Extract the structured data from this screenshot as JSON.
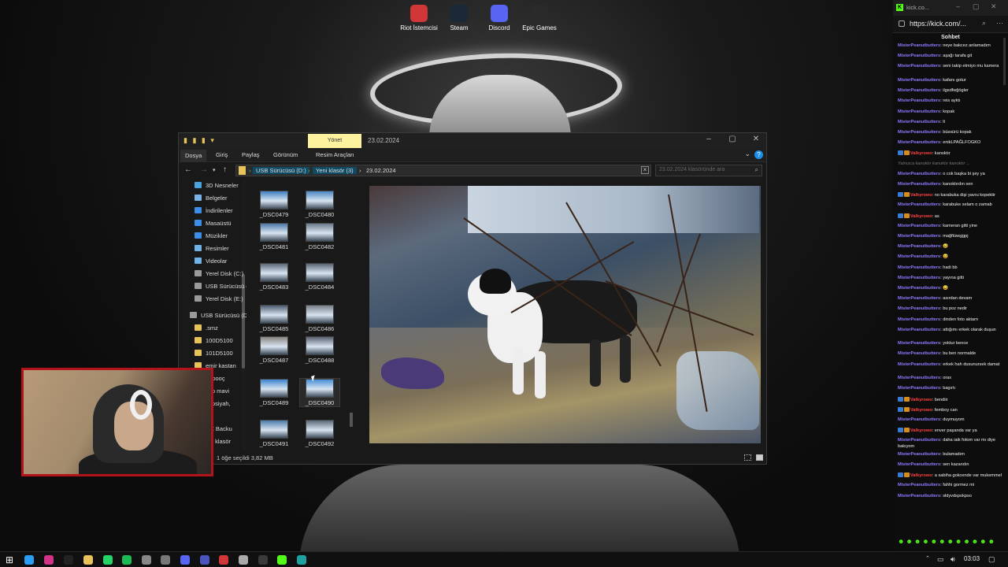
{
  "desktop": {
    "icons": [
      {
        "label": "Riot İstemcisi",
        "icon": "riot-icon",
        "color": "#d13639"
      },
      {
        "label": "Steam",
        "icon": "steam-icon",
        "color": "#1b2838"
      },
      {
        "label": "Discord",
        "icon": "discord-icon",
        "color": "#5865f2"
      },
      {
        "label": "Epic Games",
        "icon": "epic-games-icon",
        "color": "#2a2a2a"
      }
    ]
  },
  "explorer": {
    "title": "23.02.2024",
    "context_tab": "Yönet",
    "ribbon_tabs": [
      "Dosya",
      "Giriş",
      "Paylaş",
      "Görünüm",
      "Resim Araçları"
    ],
    "path": [
      "USB Sürücüsü (D:)",
      "Yeni klasör (3)",
      "23.02.2024"
    ],
    "search_placeholder": "23.02.2024 klasöründe ara",
    "nav_items": [
      {
        "label": "3D Nesneler",
        "icon": "3d-objects-icon",
        "color": "#4aa3df"
      },
      {
        "label": "Belgeler",
        "icon": "documents-icon",
        "color": "#7ab3e8"
      },
      {
        "label": "İndirilenler",
        "icon": "downloads-icon",
        "color": "#3d8ee8"
      },
      {
        "label": "Masaüstü",
        "icon": "desktop-icon",
        "color": "#3d8ee8"
      },
      {
        "label": "Müzikler",
        "icon": "music-icon",
        "color": "#3d8ee8"
      },
      {
        "label": "Resimler",
        "icon": "pictures-icon",
        "color": "#6fb3e8"
      },
      {
        "label": "Videolar",
        "icon": "videos-icon",
        "color": "#6fb3e8"
      },
      {
        "label": "Yerel Disk (C:)",
        "icon": "drive-icon",
        "color": "#9a9a9a"
      },
      {
        "label": "USB Sürücüsü (D:)",
        "icon": "usb-drive-icon",
        "color": "#9a9a9a"
      },
      {
        "label": "Yerel Disk (E:)",
        "icon": "drive-icon",
        "color": "#9a9a9a"
      },
      {
        "label": "USB Sürücüsü (D:)",
        "icon": "usb-drive-icon",
        "color": "#9a9a9a"
      },
      {
        "label": ".smz",
        "icon": "folder-icon",
        "color": "#e8c25a"
      },
      {
        "label": "100D5100",
        "icon": "folder-icon",
        "color": "#e8c25a"
      },
      {
        "label": "101D5100",
        "icon": "folder-icon",
        "color": "#e8c25a"
      },
      {
        "label": "emir kastan",
        "icon": "folder-icon",
        "color": "#e8c25a"
      },
      {
        "label": "hooooç",
        "icon": "folder-icon",
        "color": "#e8c25a"
      },
      {
        "label": "kup mavi",
        "icon": "folder-icon",
        "color": "#e8c25a"
      },
      {
        "label": "kupsiyah,",
        "icon": "folder-icon",
        "color": "#e8c25a"
      },
      {
        "label": "o",
        "icon": "folder-icon",
        "color": "#e8c25a"
      },
      {
        "label": "MZ Backu",
        "icon": "folder-icon",
        "color": "#e8c25a"
      },
      {
        "label": "eni klasör",
        "icon": "folder-icon",
        "color": "#e8c25a"
      }
    ],
    "files": [
      {
        "name": "_DSC0479",
        "color": "#3f7fc0"
      },
      {
        "name": "_DSC0480",
        "color": "#4a86c4"
      },
      {
        "name": "_DSC0481",
        "color": "#4b79a8"
      },
      {
        "name": "_DSC0482",
        "color": "#6a7a8c"
      },
      {
        "name": "_DSC0483",
        "color": "#5d6a7a"
      },
      {
        "name": "_DSC0484",
        "color": "#5a6574"
      },
      {
        "name": "_DSC0485",
        "color": "#4d5d70"
      },
      {
        "name": "_DSC0486",
        "color": "#7a7f88"
      },
      {
        "name": "_DSC0487",
        "color": "#8a8580"
      },
      {
        "name": "_DSC0488",
        "color": "#5a6070"
      },
      {
        "name": "_DSC0489",
        "color": "#3d84d0"
      },
      {
        "name": "_DSC0490",
        "color": "#4690d8"
      },
      {
        "name": "_DSC0491",
        "color": "#4d7aa8"
      },
      {
        "name": "_DSC0492",
        "color": "#5b6878"
      }
    ],
    "selected_file": "_DSC0490",
    "status": "1 öğe seçildi  3,82 MB"
  },
  "browser": {
    "tab_title": "kick.co...",
    "url": "https://kick.com/...",
    "chat_title": "Sohbet",
    "messages": [
      {
        "user": "MisterPeanutbutters",
        "text": "neye bakcez anlamadım"
      },
      {
        "user": "MisterPeanutbutters",
        "text": "aşağı tarafa git"
      },
      {
        "user": "MisterPeanutbutters",
        "text": "seni takip etmiyo mu kamera"
      },
      {
        "user": "MisterPeanutbutters",
        "text": "kafanı gotur"
      },
      {
        "user": "MisterPeanutbutters",
        "text": "ilgsdfwğögler"
      },
      {
        "user": "MisterPeanutbutters",
        "text": "reis ayktı"
      },
      {
        "user": "MisterPeanutbutters",
        "text": "kopak"
      },
      {
        "user": "MisterPeanutbutters",
        "text": "lt"
      },
      {
        "user": "MisterPeanutbutters",
        "text": "büssürü kopak"
      },
      {
        "user": "MisterPeanutbutters",
        "text": "enikLPAĞLFOGKO"
      },
      {
        "user": "Valkyrowo",
        "text": "kanoktır",
        "mod": true
      },
      {
        "user": "",
        "text": "Yalnızca kanoktır kanoktır kanoktır ...",
        "system": true
      },
      {
        "user": "MisterPeanutbutters",
        "text": "o cok başka bi şey ya"
      },
      {
        "user": "MisterPeanutbutters",
        "text": "kanoktırdın sen"
      },
      {
        "user": "Valkyrowo",
        "text": "no karabuka dişi yavru kopektir",
        "mod": true
      },
      {
        "user": "MisterPeanutbutters",
        "text": "karabuke selam o zamab"
      },
      {
        "user": "Valkyrowo",
        "text": "as",
        "mod": true
      },
      {
        "user": "MisterPeanutbutters",
        "text": "kameran gitti yine"
      },
      {
        "user": "MisterPeanutbutters",
        "text": "mağfiüwşjgpj"
      },
      {
        "user": "MisterPeanutbutters",
        "text": "😅"
      },
      {
        "user": "MisterPeanutbutters",
        "text": "😅"
      },
      {
        "user": "MisterPeanutbutters",
        "text": "hadi bb"
      },
      {
        "user": "MisterPeanutbutters",
        "text": "yayına gitti"
      },
      {
        "user": "MisterPeanutbutters",
        "text": "😅"
      },
      {
        "user": "MisterPeanutbutters",
        "text": "asırdan devam"
      },
      {
        "user": "MisterPeanutbutters",
        "text": "bu poz nedir"
      },
      {
        "user": "MisterPeanutbutters",
        "text": "dinden foto aktarn"
      },
      {
        "user": "MisterPeanutbutters",
        "text": "attığımı erkek olarak duşun"
      },
      {
        "user": "MisterPeanutbutters",
        "text": "yoktur bence"
      },
      {
        "user": "MisterPeanutbutters",
        "text": "bu ben normalde"
      },
      {
        "user": "MisterPeanutbutters",
        "text": "erkek hah dusunursek damat"
      },
      {
        "user": "MisterPeanutbutters",
        "text": "orax"
      },
      {
        "user": "MisterPeanutbutters",
        "text": "bagırtı"
      },
      {
        "user": "Valkyrowo",
        "text": "bendiir",
        "mod": true
      },
      {
        "user": "Valkyrowo",
        "text": "femboy can",
        "mod": true
      },
      {
        "user": "MisterPeanutbutters",
        "text": "duymuyom"
      },
      {
        "user": "Valkyrowo",
        "text": "enver paşanda var ya",
        "mod": true
      },
      {
        "user": "MisterPeanutbutters",
        "text": "daha iaik fotom var mı diye bakıyom"
      },
      {
        "user": "MisterPeanutbutters",
        "text": "bulamadım"
      },
      {
        "user": "MisterPeanutbutters",
        "text": "sen kazandın"
      },
      {
        "user": "Valkyrowo",
        "text": "a sabiha gokcende var mukemmel",
        "mod": true
      },
      {
        "user": "MisterPeanutbutters",
        "text": "fahhi gormez mi"
      },
      {
        "user": "MisterPeanutbutters",
        "text": "sldyvdspokpso"
      }
    ]
  },
  "taskbar": {
    "apps": [
      {
        "icon": "start-icon",
        "color": "#ffffff"
      },
      {
        "icon": "chrome-icon",
        "color": "#2a9df4"
      },
      {
        "icon": "instagram-icon",
        "color": "#d13486"
      },
      {
        "icon": "tiktok-icon",
        "color": "#222222"
      },
      {
        "icon": "file-explorer-icon",
        "color": "#e8c25a"
      },
      {
        "icon": "whatsapp-icon",
        "color": "#25d366"
      },
      {
        "icon": "spotify-icon",
        "color": "#1db954"
      },
      {
        "icon": "chatgpt-icon",
        "color": "#888888"
      },
      {
        "icon": "clock-icon",
        "color": "#777777"
      },
      {
        "icon": "discord-icon",
        "color": "#5865f2"
      },
      {
        "icon": "teams-icon",
        "color": "#4b53bc"
      },
      {
        "icon": "riot-icon",
        "color": "#d13639"
      },
      {
        "icon": "settings-icon",
        "color": "#aaaaaa"
      },
      {
        "icon": "obs-icon",
        "color": "#3a3a3a"
      },
      {
        "icon": "kick-icon",
        "color": "#53fc18"
      },
      {
        "icon": "edge-icon",
        "color": "#1ea1a1"
      }
    ],
    "time": "03:03"
  }
}
